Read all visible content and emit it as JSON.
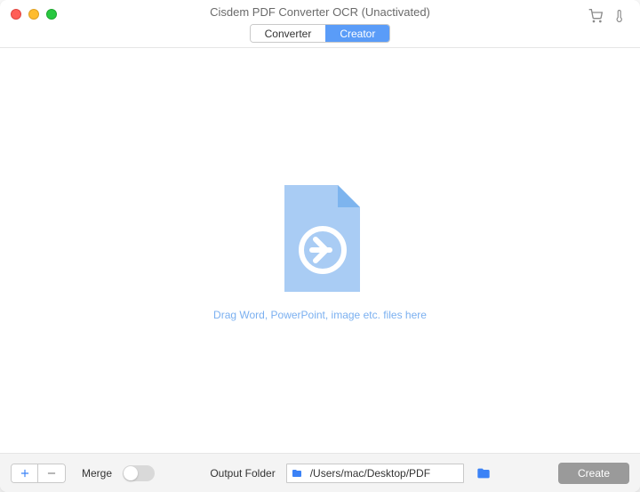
{
  "window": {
    "title": "Cisdem PDF Converter OCR (Unactivated)"
  },
  "tabs": {
    "converter": "Converter",
    "creator": "Creator"
  },
  "dropzone": {
    "hint": "Drag Word, PowerPoint, image etc. files here"
  },
  "bottombar": {
    "merge_label": "Merge",
    "merge_on": false,
    "output_label": "Output Folder",
    "output_path": "/Users/mac/Desktop/PDF",
    "create_label": "Create"
  },
  "colors": {
    "accent": "#5a9cf8",
    "file_fill": "#a9ccf4",
    "file_fold": "#7db4ee"
  }
}
